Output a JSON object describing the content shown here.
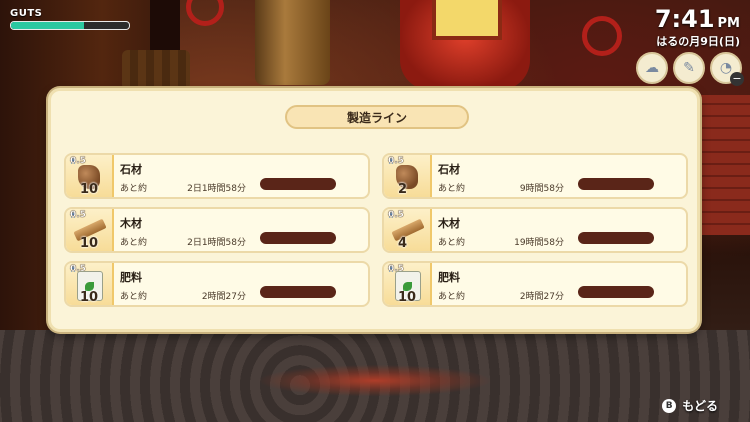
{
  "hud": {
    "guts_label": "GUTS",
    "guts_fraction": 0.62,
    "time": "7:41",
    "ampm": "PM",
    "date": "はるの月9日(日)",
    "icons": [
      "weather-cloudy-icon",
      "tool-bag-icon",
      "item-bag-icon"
    ]
  },
  "panel": {
    "title": "製造ライン"
  },
  "lines": [
    {
      "name": "石材",
      "qty": "10",
      "rate": "0.5",
      "remain_label": "あと約",
      "remain": "2日1時間58分",
      "kind": "stone"
    },
    {
      "name": "石材",
      "qty": "2",
      "rate": "0.5",
      "remain_label": "あと約",
      "remain": "9時間58分",
      "kind": "stone"
    },
    {
      "name": "木材",
      "qty": "10",
      "rate": "0.5",
      "remain_label": "あと約",
      "remain": "2日1時間58分",
      "kind": "wood"
    },
    {
      "name": "木材",
      "qty": "4",
      "rate": "0.5",
      "remain_label": "あと約",
      "remain": "19時間58分",
      "kind": "wood"
    },
    {
      "name": "肥料",
      "qty": "10",
      "rate": "0.5",
      "remain_label": "あと約",
      "remain": "2時間27分",
      "kind": "fertilizer"
    },
    {
      "name": "肥料",
      "qty": "10",
      "rate": "0.5",
      "remain_label": "あと約",
      "remain": "2時間27分",
      "kind": "fertilizer"
    }
  ],
  "footer": {
    "button": "B",
    "label": "もどる"
  },
  "colors": {
    "guts_fill": "#2bc8a0",
    "progress_bar": "#5a2518",
    "panel_bg": "#fbf4d8"
  }
}
